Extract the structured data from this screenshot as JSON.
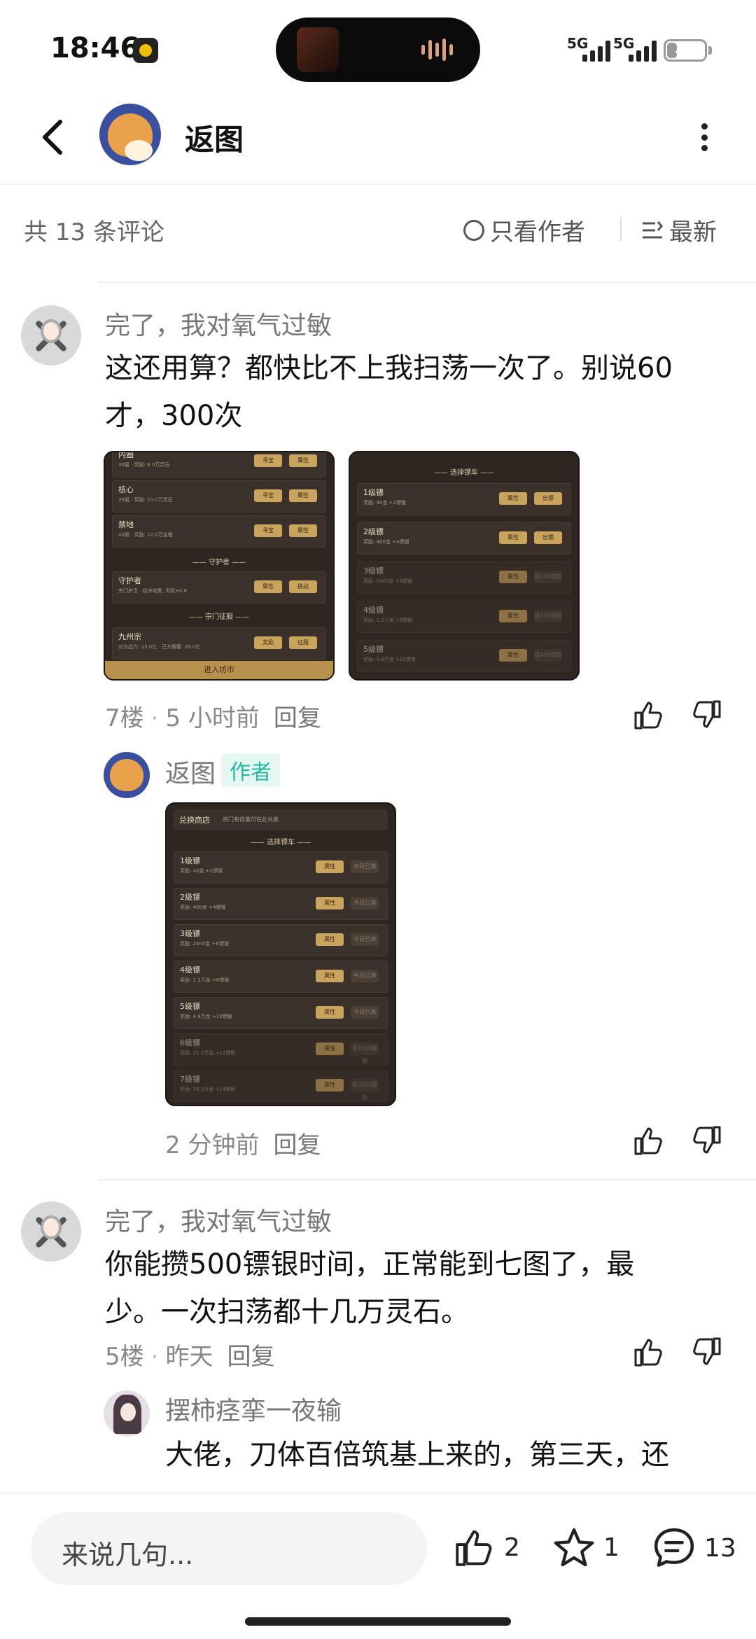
{
  "status": {
    "time": "18:46",
    "signal1": "5G",
    "signal2": "5G",
    "battery": "27",
    "battery_level_pct": 27
  },
  "header": {
    "title": "返图"
  },
  "comment_bar": {
    "count": "共 13 条评论",
    "author_only": "只看作者",
    "sort": "最新"
  },
  "comments": [
    {
      "user": "完了，我对氧气过敏",
      "text_line1": "这还用算？都快比不上我扫荡一次了。别说60",
      "text_line2": "才，300次",
      "floor": "7楼",
      "time": "5 小时前",
      "reply": "回复",
      "images": {
        "left": {
          "rows": [
            {
              "title": "内圈",
              "sub": "30层 · 奖励: 6.0万灵石",
              "b1": "寻宝",
              "b2": "属性"
            },
            {
              "title": "核心",
              "sub": "39层 · 奖励: 10.0万灵石",
              "b1": "寻宝",
              "b2": "属性"
            },
            {
              "title": "禁地",
              "sub": "40层 · 奖励: 12.0万金橙",
              "b1": "寻宝",
              "b2": "属性"
            }
          ],
          "section1": "守护者",
          "guardian": {
            "title": "守护者",
            "sub": "宗门护卫 · 经济收集, 天赋+0.8",
            "b1": "属性",
            "b2": "挑战"
          },
          "section2": "宗门征服",
          "sect": {
            "title": "九州宗",
            "sub": "对方战力: 13.0亿 · 己方需要: 26.0亿",
            "b1": "奖励",
            "b2": "征服"
          },
          "footer": "进入坊市"
        },
        "right": {
          "section": "选择镖车",
          "rows": [
            {
              "title": "1级镖",
              "sub": "奖励: 40金 +2镖银",
              "b1": "属性",
              "b2": "出镖"
            },
            {
              "title": "2级镖",
              "sub": "奖励: 400金 +4镖银",
              "b1": "属性",
              "b2": "出镖"
            },
            {
              "title": "3级镖",
              "sub": "奖励: 2400金 +6镖银",
              "b1": "属性",
              "b2": "需100镖银"
            },
            {
              "title": "4级镖",
              "sub": "奖励: 1.2万金 +8镖银",
              "b1": "属性",
              "b2": "需200镖银"
            },
            {
              "title": "5级镖",
              "sub": "奖励: 4.8万金 +10镖银",
              "b1": "属性",
              "b2": "需400镖银"
            }
          ]
        }
      }
    },
    {
      "user": "返图",
      "tag": "作者",
      "time": "2 分钟前",
      "reply": "回复",
      "image": {
        "top_title": "兑换商店",
        "top_sub": "宗门有商量可在此兑换",
        "section": "选择镖车",
        "rows": [
          {
            "title": "1级镖",
            "sub": "奖励: 40金 +2镖银",
            "b1": "属性",
            "b2": "今日已满"
          },
          {
            "title": "2级镖",
            "sub": "奖励: 400金 +4镖银",
            "b1": "属性",
            "b2": "今日已满"
          },
          {
            "title": "3级镖",
            "sub": "奖励: 2400金 +6镖银",
            "b1": "属性",
            "b2": "今日已满"
          },
          {
            "title": "4级镖",
            "sub": "奖励: 1.2万金 +8镖银",
            "b1": "属性",
            "b2": "今日已满"
          },
          {
            "title": "5级镖",
            "sub": "奖励: 4.8万金 +10镖银",
            "b1": "属性",
            "b2": "今日已满"
          },
          {
            "title": "6级镖",
            "sub": "奖励: 21.2万金 +12镖银",
            "b1": "属性",
            "b2": "需1000镖银"
          },
          {
            "title": "7级镖",
            "sub": "奖励: 76.5万金 +14镖银",
            "b1": "属性",
            "b2": "需2500镖银"
          }
        ]
      }
    },
    {
      "user": "完了，我对氧气过敏",
      "text_line1": "你能攒500镖银时间，正常能到七图了，最",
      "text_line2": "少。一次扫荡都十几万灵石。",
      "floor": "5楼",
      "time": "昨天",
      "reply": "回复"
    },
    {
      "user": "摆柿痉挛一夜输",
      "text_line1": "大佬，刀体百倍筑基上来的，第三天，还"
    }
  ],
  "bottom": {
    "placeholder": "来说几句...",
    "likes": "2",
    "favorites": "1",
    "comments": "13"
  }
}
